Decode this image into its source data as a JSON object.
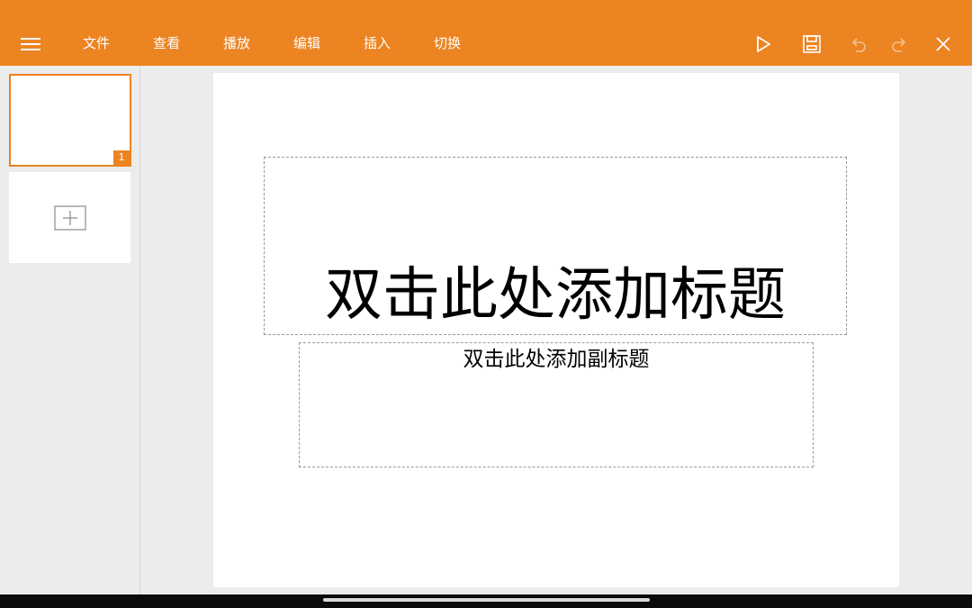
{
  "theme": {
    "accent": "#ec8422",
    "background": "#ececec"
  },
  "toolbar": {
    "menu_icon": "hamburger-icon",
    "tabs": [
      {
        "label": "文件"
      },
      {
        "label": "查看"
      },
      {
        "label": "播放"
      },
      {
        "label": "编辑"
      },
      {
        "label": "插入"
      },
      {
        "label": "切换"
      }
    ],
    "actions": [
      "play-icon",
      "save-icon",
      "undo-icon",
      "redo-icon",
      "close-icon"
    ]
  },
  "sidebar": {
    "slides": [
      {
        "number": "1",
        "selected": true
      }
    ],
    "add_icon": "add-slide-icon"
  },
  "slide": {
    "title_placeholder": "双击此处添加标题",
    "subtitle_placeholder": "双击此处添加副标题"
  }
}
